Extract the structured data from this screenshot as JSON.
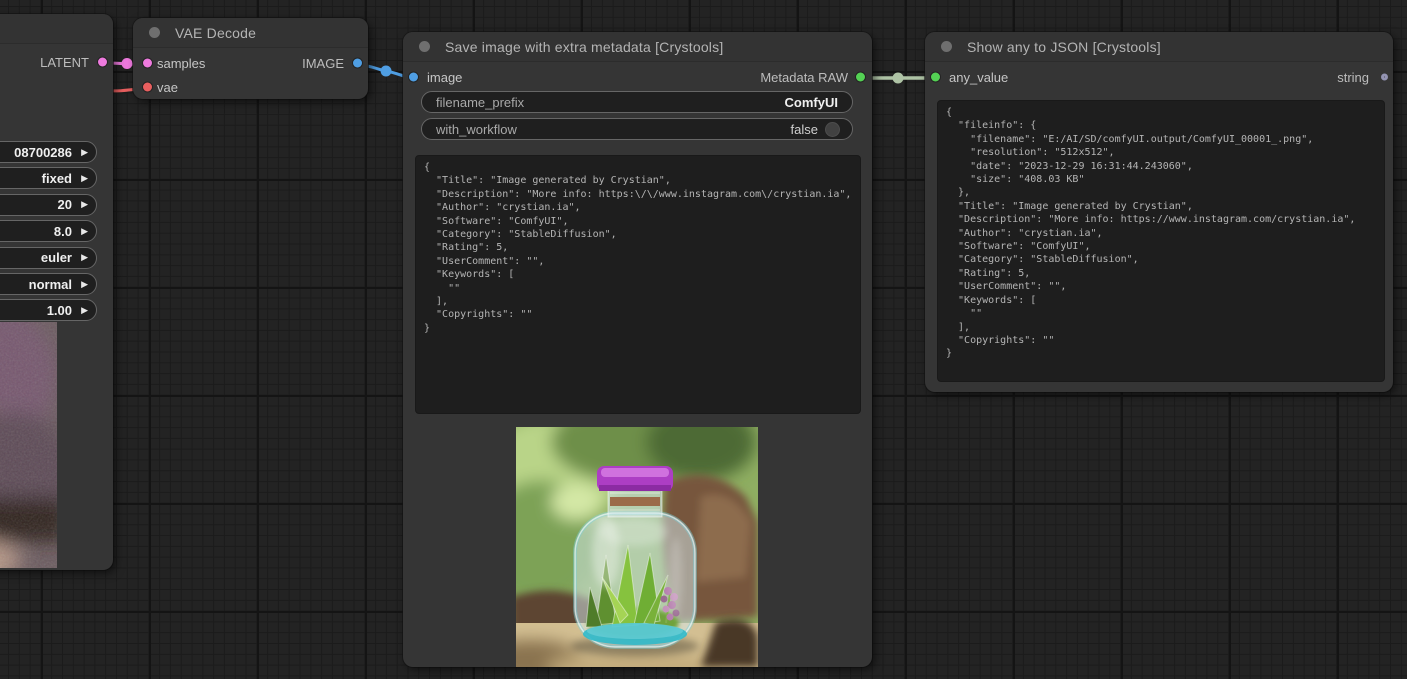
{
  "colors": {
    "latent_link": "#ee7ade",
    "vae_link": "#e95f5f",
    "image_link": "#4f9ee3",
    "metadata_link": "#aec3a5",
    "metadata_dot": "#54d154",
    "string_dot": "#9494b2"
  },
  "icons": {
    "arrow_right": "▶"
  },
  "nodes": {
    "ksampler": {
      "output_label": "LATENT",
      "widgets": [
        {
          "value": "08700286"
        },
        {
          "value": "fixed"
        },
        {
          "value": "20"
        },
        {
          "value": "8.0"
        },
        {
          "value": "euler"
        },
        {
          "value": "normal"
        },
        {
          "value": "1.00"
        }
      ]
    },
    "vae_decode": {
      "title": "VAE Decode",
      "input_samples": "samples",
      "input_vae": "vae",
      "output_label": "IMAGE"
    },
    "save_image": {
      "title": "Save image with extra metadata [Crystools]",
      "input_label": "image",
      "output_label": "Metadata RAW",
      "filename_prefix_label": "filename_prefix",
      "filename_prefix_value": "ComfyUI",
      "with_workflow_label": "with_workflow",
      "with_workflow_value": "false",
      "json_text": "{\n  \"Title\": \"Image generated by Crystian\",\n  \"Description\": \"More info: https:\\/\\/www.instagram.com\\/crystian.ia\",\n  \"Author\": \"crystian.ia\",\n  \"Software\": \"ComfyUI\",\n  \"Category\": \"StableDiffusion\",\n  \"Rating\": 5,\n  \"UserComment\": \"\",\n  \"Keywords\": [\n    \"\"\n  ],\n  \"Copyrights\": \"\"\n}"
    },
    "show_json": {
      "title": "Show any to JSON [Crystools]",
      "input_label": "any_value",
      "output_label": "string",
      "json_text": "{\n  \"fileinfo\": {\n    \"filename\": \"E:/AI/SD/comfyUI.output/ComfyUI_00001_.png\",\n    \"resolution\": \"512x512\",\n    \"date\": \"2023-12-29 16:31:44.243060\",\n    \"size\": \"408.03 KB\"\n  },\n  \"Title\": \"Image generated by Crystian\",\n  \"Description\": \"More info: https://www.instagram.com/crystian.ia\",\n  \"Author\": \"crystian.ia\",\n  \"Software\": \"ComfyUI\",\n  \"Category\": \"StableDiffusion\",\n  \"Rating\": 5,\n  \"UserComment\": \"\",\n  \"Keywords\": [\n    \"\"\n  ],\n  \"Copyrights\": \"\"\n}"
    }
  }
}
